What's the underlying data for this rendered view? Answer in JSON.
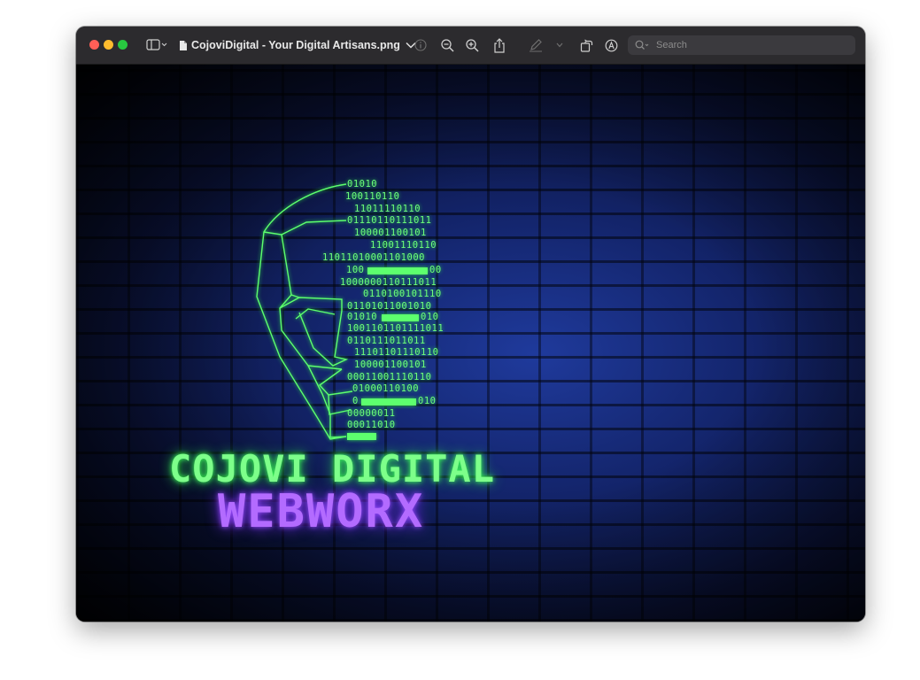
{
  "window": {
    "title": "CojoviDigital - Your Digital Artisans.png",
    "search_placeholder": "Search"
  },
  "toolbar_icons": [
    "sidebar-icon",
    "document-icon",
    "chevron-down-icon",
    "info-icon",
    "zoom-out-icon",
    "zoom-in-icon",
    "share-icon",
    "markup-pen-icon",
    "rotate-icon",
    "annotate-icon",
    "search-icon"
  ],
  "image": {
    "binary_lines": [
      "01010",
      "100110110",
      "11011110110",
      "01110110111011",
      "100001100101",
      "11001110110",
      "11011010001101000",
      "100",
      "00",
      "1000000110111011",
      "0110100101110",
      "01101011001010",
      "01010",
      "010",
      "1001101101111011",
      "0110111011011",
      "11101101110110",
      "100001100101",
      "00011001110110",
      "01000110100",
      "0",
      "010",
      "00000011",
      "00011010"
    ],
    "headline": "COJOVI DIGITAL",
    "subline": "WEBWORX",
    "colors": {
      "neon_green": "#7dff8a",
      "neon_purple": "#b36bff",
      "wall_blue": "#1f3a9c"
    }
  }
}
